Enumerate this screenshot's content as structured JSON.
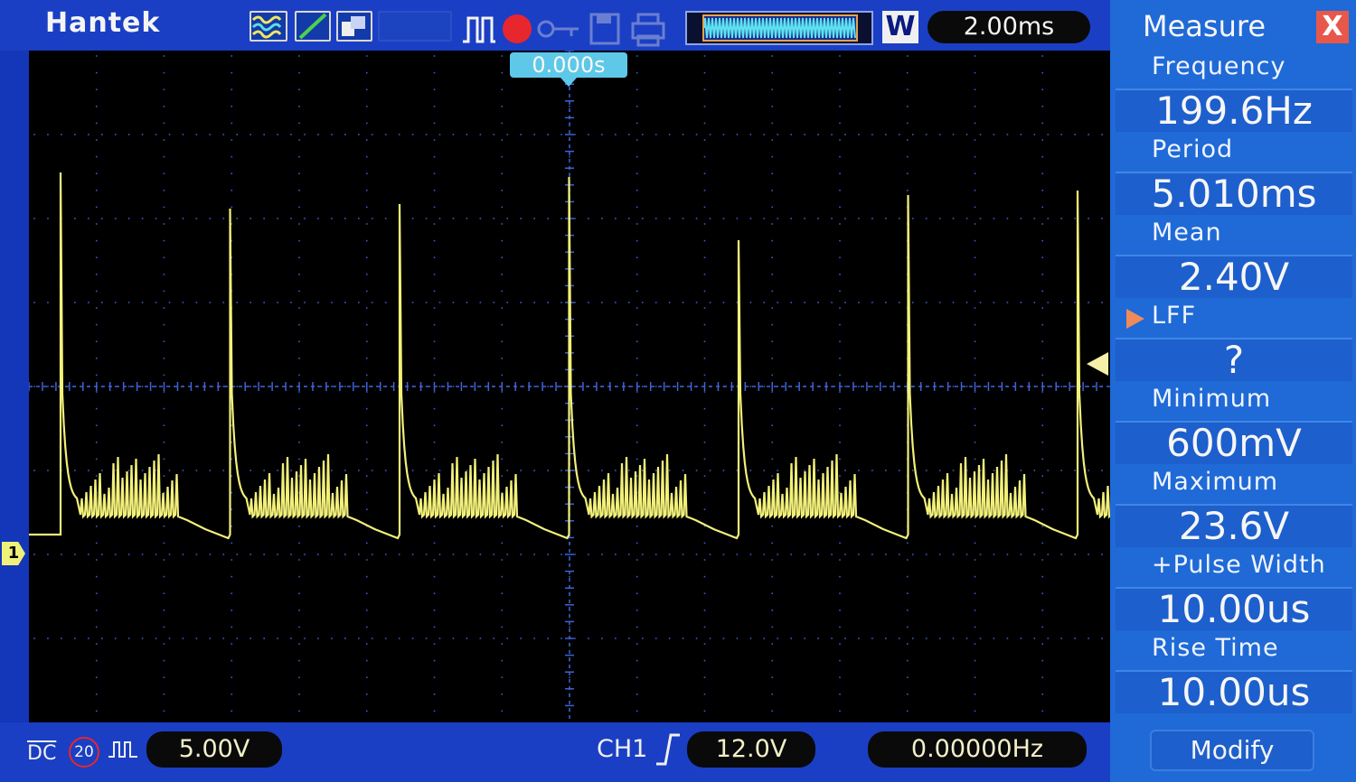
{
  "header": {
    "brand": "Hantek",
    "timebase": "2.00ms",
    "window_mode": "W",
    "icons": [
      "waveform-mode-icon",
      "line-mode-icon",
      "persistence-icon",
      "pulse-icon",
      "record-icon",
      "key-icon",
      "save-icon",
      "print-icon"
    ]
  },
  "scope": {
    "trigger_time": "0.000s",
    "channel_marker": "1",
    "trace_color": "#f2f07a",
    "grid_color": "#3c5ac8"
  },
  "footer": {
    "coupling": "DC",
    "bandwidth_limit": "20",
    "ch1_scale": "5.00V",
    "trigger_source": "CH1",
    "trigger_level": "12.0V",
    "trigger_freq": "0.00000Hz"
  },
  "measure": {
    "title": "Measure",
    "close": "X",
    "items": [
      {
        "label": "Frequency",
        "value": "199.6Hz"
      },
      {
        "label": "Period",
        "value": "5.010ms"
      },
      {
        "label": "Mean",
        "value": "2.40V"
      },
      {
        "label": "LFF",
        "value": "?"
      },
      {
        "label": "Minimum",
        "value": "600mV"
      },
      {
        "label": "Maximum",
        "value": "23.6V"
      },
      {
        "label": "+Pulse Width",
        "value": "10.00us"
      },
      {
        "label": "Rise Time",
        "value": "10.00us"
      }
    ],
    "modify": "Modify"
  }
}
